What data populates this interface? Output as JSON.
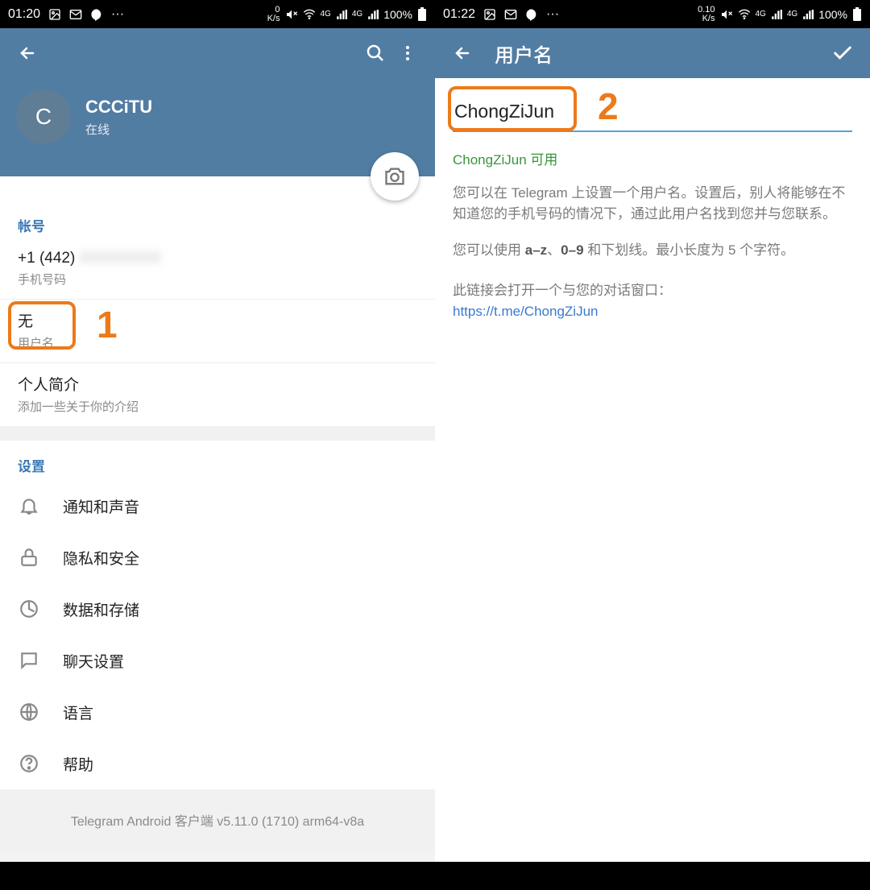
{
  "left": {
    "status": {
      "time": "01:20",
      "ks": "0",
      "ks_unit": "K/s",
      "net": "4G",
      "battery": "100%"
    },
    "profile": {
      "avatar_letter": "C",
      "name": "CCCiTU",
      "status": "在线"
    },
    "account": {
      "header": "帐号",
      "phone": "+1 (442) ",
      "phone_label": "手机号码",
      "username_value": "无",
      "username_label": "用户名",
      "bio_title": "个人简介",
      "bio_hint": "添加一些关于你的介绍"
    },
    "settings": {
      "header": "设置",
      "items": [
        {
          "label": "通知和声音"
        },
        {
          "label": "隐私和安全"
        },
        {
          "label": "数据和存储"
        },
        {
          "label": "聊天设置"
        },
        {
          "label": "语言"
        },
        {
          "label": "帮助"
        }
      ]
    },
    "footer": "Telegram Android 客户端 v5.11.0 (1710) arm64-v8a",
    "annot_num": "1"
  },
  "right": {
    "status": {
      "time": "01:22",
      "ks": "0.10",
      "ks_unit": "K/s",
      "net": "4G",
      "battery": "100%"
    },
    "title": "用户名",
    "input_value": "ChongZiJun",
    "available": "ChongZiJun 可用",
    "desc1": "您可以在 Telegram 上设置一个用户名。设置后，别人将能够在不知道您的手机号码的情况下，通过此用户名找到您并与您联系。",
    "desc2_pre": "您可以使用 ",
    "desc2_b1": "a–z",
    "desc2_mid": "、",
    "desc2_b2": "0–9",
    "desc2_post": " 和下划线。最小长度为 5 个字符。",
    "link_line": "此链接会打开一个与您的对话窗口：",
    "link_url": "https://t.me/ChongZiJun",
    "annot_num": "2"
  }
}
